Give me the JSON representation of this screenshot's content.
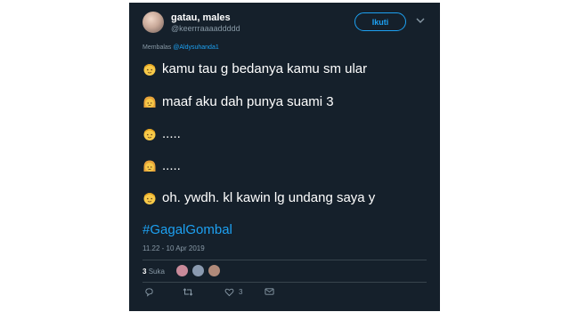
{
  "tweet": {
    "display_name": "gatau, males",
    "handle": "@keerrraaaaddddd",
    "follow_label": "Ikuti",
    "replying_prefix": "Membalas",
    "replying_to": "@Aldysuhanda1",
    "lines": [
      {
        "emoji": "man-emoji",
        "text": "kamu tau g bedanya kamu sm ular"
      },
      {
        "emoji": "woman-emoji",
        "text": "maaf aku dah punya suami 3"
      },
      {
        "emoji": "man-emoji",
        "text": "....."
      },
      {
        "emoji": "woman-emoji",
        "text": "....."
      },
      {
        "emoji": "man-emoji",
        "text": "oh. ywdh. kl kawin lg undang saya y"
      }
    ],
    "hashtag": "#GagalGombal",
    "timestamp": "11.22 - 10 Apr 2019",
    "likes_count": "3",
    "likes_label": "Suka",
    "like_action_count": "3"
  },
  "colors": {
    "background": "#15202b",
    "accent": "#1da1f2",
    "muted": "#8899a6",
    "divider": "#38444d"
  },
  "icons": {
    "reply": "reply-icon",
    "retweet": "retweet-icon",
    "like": "heart-icon",
    "message": "envelope-icon",
    "menu": "chevron-down-icon"
  }
}
